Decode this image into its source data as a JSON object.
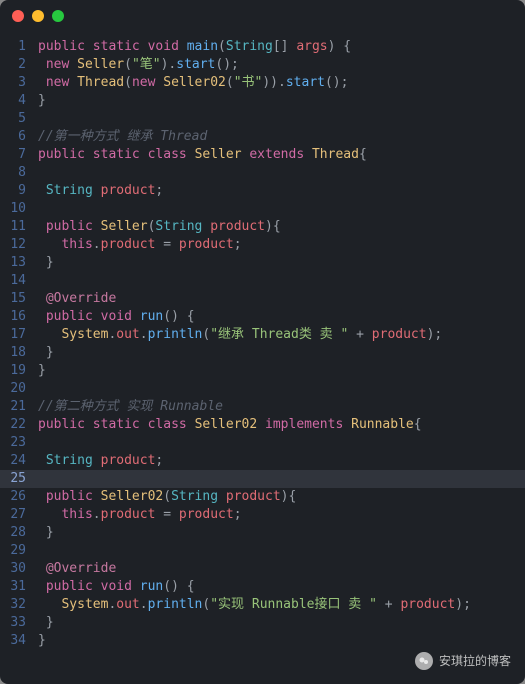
{
  "titlebar": {
    "dots": [
      "red",
      "yellow",
      "green"
    ]
  },
  "watermark": {
    "text": "安琪拉的博客"
  },
  "cursor_line": 25,
  "code": {
    "lines": [
      {
        "n": 1,
        "tokens": [
          [
            "kw",
            "public"
          ],
          [
            "pun",
            " "
          ],
          [
            "kw",
            "static"
          ],
          [
            "pun",
            " "
          ],
          [
            "kw",
            "void"
          ],
          [
            "pun",
            " "
          ],
          [
            "fn",
            "main"
          ],
          [
            "pun",
            "("
          ],
          [
            "typeN",
            "String"
          ],
          [
            "pun",
            "[] "
          ],
          [
            "id",
            "args"
          ],
          [
            "pun",
            ") {"
          ]
        ]
      },
      {
        "n": 2,
        "tokens": [
          [
            "pun",
            " "
          ],
          [
            "kw",
            "new"
          ],
          [
            "pun",
            " "
          ],
          [
            "cls",
            "Seller"
          ],
          [
            "pun",
            "("
          ],
          [
            "str",
            "\"笔\""
          ],
          [
            "pun",
            ")."
          ],
          [
            "fn",
            "start"
          ],
          [
            "pun",
            "();"
          ]
        ]
      },
      {
        "n": 3,
        "tokens": [
          [
            "pun",
            " "
          ],
          [
            "kw",
            "new"
          ],
          [
            "pun",
            " "
          ],
          [
            "cls",
            "Thread"
          ],
          [
            "pun",
            "("
          ],
          [
            "kw",
            "new"
          ],
          [
            "pun",
            " "
          ],
          [
            "cls",
            "Seller02"
          ],
          [
            "pun",
            "("
          ],
          [
            "str",
            "\"书\""
          ],
          [
            "pun",
            "))."
          ],
          [
            "fn",
            "start"
          ],
          [
            "pun",
            "();"
          ]
        ]
      },
      {
        "n": 4,
        "tokens": [
          [
            "pun",
            "}"
          ]
        ]
      },
      {
        "n": 5,
        "tokens": []
      },
      {
        "n": 6,
        "tokens": [
          [
            "cmt",
            "//第一种方式 继承 Thread"
          ]
        ]
      },
      {
        "n": 7,
        "tokens": [
          [
            "kw",
            "public"
          ],
          [
            "pun",
            " "
          ],
          [
            "kw",
            "static"
          ],
          [
            "pun",
            " "
          ],
          [
            "kw",
            "class"
          ],
          [
            "pun",
            " "
          ],
          [
            "cls",
            "Seller"
          ],
          [
            "pun",
            " "
          ],
          [
            "kw",
            "extends"
          ],
          [
            "pun",
            " "
          ],
          [
            "cls",
            "Thread"
          ],
          [
            "pun",
            "{"
          ]
        ]
      },
      {
        "n": 8,
        "tokens": []
      },
      {
        "n": 9,
        "tokens": [
          [
            "pun",
            " "
          ],
          [
            "typeN",
            "String"
          ],
          [
            "pun",
            " "
          ],
          [
            "id",
            "product"
          ],
          [
            "pun",
            ";"
          ]
        ]
      },
      {
        "n": 10,
        "tokens": []
      },
      {
        "n": 11,
        "tokens": [
          [
            "pun",
            " "
          ],
          [
            "kw",
            "public"
          ],
          [
            "pun",
            " "
          ],
          [
            "cls",
            "Seller"
          ],
          [
            "pun",
            "("
          ],
          [
            "typeN",
            "String"
          ],
          [
            "pun",
            " "
          ],
          [
            "id",
            "product"
          ],
          [
            "pun",
            "){"
          ]
        ]
      },
      {
        "n": 12,
        "tokens": [
          [
            "pun",
            "   "
          ],
          [
            "kw",
            "this"
          ],
          [
            "pun",
            "."
          ],
          [
            "id",
            "product"
          ],
          [
            "pun",
            " = "
          ],
          [
            "id",
            "product"
          ],
          [
            "pun",
            ";"
          ]
        ]
      },
      {
        "n": 13,
        "tokens": [
          [
            "pun",
            " }"
          ]
        ]
      },
      {
        "n": 14,
        "tokens": []
      },
      {
        "n": 15,
        "tokens": [
          [
            "pun",
            " "
          ],
          [
            "ann",
            "@Override"
          ]
        ]
      },
      {
        "n": 16,
        "tokens": [
          [
            "pun",
            " "
          ],
          [
            "kw",
            "public"
          ],
          [
            "pun",
            " "
          ],
          [
            "kw",
            "void"
          ],
          [
            "pun",
            " "
          ],
          [
            "fn",
            "run"
          ],
          [
            "pun",
            "() {"
          ]
        ]
      },
      {
        "n": 17,
        "tokens": [
          [
            "pun",
            "   "
          ],
          [
            "cls",
            "System"
          ],
          [
            "pun",
            "."
          ],
          [
            "id",
            "out"
          ],
          [
            "pun",
            "."
          ],
          [
            "fn",
            "println"
          ],
          [
            "pun",
            "("
          ],
          [
            "str",
            "\"继承 Thread类 卖 \""
          ],
          [
            "pun",
            " + "
          ],
          [
            "id",
            "product"
          ],
          [
            "pun",
            ");"
          ]
        ]
      },
      {
        "n": 18,
        "tokens": [
          [
            "pun",
            " }"
          ]
        ]
      },
      {
        "n": 19,
        "tokens": [
          [
            "pun",
            "}"
          ]
        ]
      },
      {
        "n": 20,
        "tokens": []
      },
      {
        "n": 21,
        "tokens": [
          [
            "cmt",
            "//第二种方式 实现 Runnable"
          ]
        ]
      },
      {
        "n": 22,
        "tokens": [
          [
            "kw",
            "public"
          ],
          [
            "pun",
            " "
          ],
          [
            "kw",
            "static"
          ],
          [
            "pun",
            " "
          ],
          [
            "kw",
            "class"
          ],
          [
            "pun",
            " "
          ],
          [
            "cls",
            "Seller02"
          ],
          [
            "pun",
            " "
          ],
          [
            "kw",
            "implements"
          ],
          [
            "pun",
            " "
          ],
          [
            "cls",
            "Runnable"
          ],
          [
            "pun",
            "{"
          ]
        ]
      },
      {
        "n": 23,
        "tokens": []
      },
      {
        "n": 24,
        "tokens": [
          [
            "pun",
            " "
          ],
          [
            "typeN",
            "String"
          ],
          [
            "pun",
            " "
          ],
          [
            "id",
            "product"
          ],
          [
            "pun",
            ";"
          ]
        ]
      },
      {
        "n": 25,
        "tokens": []
      },
      {
        "n": 26,
        "tokens": [
          [
            "pun",
            " "
          ],
          [
            "kw",
            "public"
          ],
          [
            "pun",
            " "
          ],
          [
            "cls",
            "Seller02"
          ],
          [
            "pun",
            "("
          ],
          [
            "typeN",
            "String"
          ],
          [
            "pun",
            " "
          ],
          [
            "id",
            "product"
          ],
          [
            "pun",
            "){"
          ]
        ]
      },
      {
        "n": 27,
        "tokens": [
          [
            "pun",
            "   "
          ],
          [
            "kw",
            "this"
          ],
          [
            "pun",
            "."
          ],
          [
            "id",
            "product"
          ],
          [
            "pun",
            " = "
          ],
          [
            "id",
            "product"
          ],
          [
            "pun",
            ";"
          ]
        ]
      },
      {
        "n": 28,
        "tokens": [
          [
            "pun",
            " }"
          ]
        ]
      },
      {
        "n": 29,
        "tokens": []
      },
      {
        "n": 30,
        "tokens": [
          [
            "pun",
            " "
          ],
          [
            "ann",
            "@Override"
          ]
        ]
      },
      {
        "n": 31,
        "tokens": [
          [
            "pun",
            " "
          ],
          [
            "kw",
            "public"
          ],
          [
            "pun",
            " "
          ],
          [
            "kw",
            "void"
          ],
          [
            "pun",
            " "
          ],
          [
            "fn",
            "run"
          ],
          [
            "pun",
            "() {"
          ]
        ]
      },
      {
        "n": 32,
        "tokens": [
          [
            "pun",
            "   "
          ],
          [
            "cls",
            "System"
          ],
          [
            "pun",
            "."
          ],
          [
            "id",
            "out"
          ],
          [
            "pun",
            "."
          ],
          [
            "fn",
            "println"
          ],
          [
            "pun",
            "("
          ],
          [
            "str",
            "\"实现 Runnable接口 卖 \""
          ],
          [
            "pun",
            " + "
          ],
          [
            "id",
            "product"
          ],
          [
            "pun",
            ");"
          ]
        ]
      },
      {
        "n": 33,
        "tokens": [
          [
            "pun",
            " }"
          ]
        ]
      },
      {
        "n": 34,
        "tokens": [
          [
            "pun",
            "}"
          ]
        ]
      }
    ]
  }
}
